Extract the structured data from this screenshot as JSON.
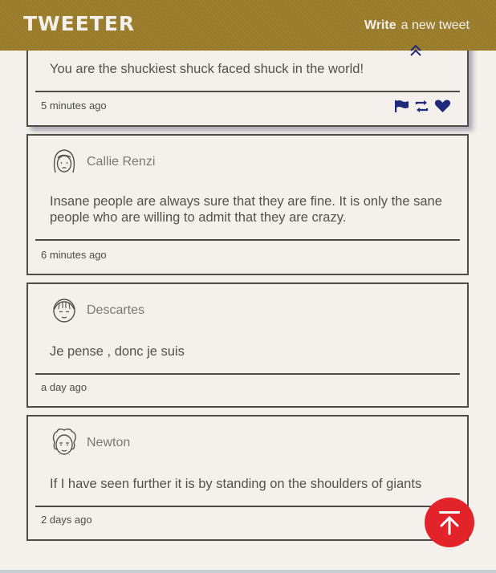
{
  "nav": {
    "brand": "TWEETER",
    "write_label": "Write",
    "new_tweet_label": "a new tweet"
  },
  "tweets": [
    {
      "content": "You are the shuckiest shuck faced shuck in the world!",
      "time": "5 minutes ago",
      "actions": [
        "flag-icon",
        "retweet-icon",
        "heart-icon"
      ]
    },
    {
      "handle": "Callie Renzi",
      "content": "Insane people are always sure that they are fine. It is only the sane people who are willing to admit that they are crazy.",
      "time": "6 minutes ago"
    },
    {
      "handle": "Descartes",
      "content": "Je pense , donc je suis",
      "time": "a day ago"
    },
    {
      "handle": "Newton",
      "content": "If I have seen further it is by standing on the shoulders of giants",
      "time": "2 days ago"
    }
  ],
  "colors": {
    "nav_bg": "#9c7e2b",
    "page_bg": "#f4f1ec",
    "accent_navy": "#1f2a7a",
    "fab_red": "#e3232a"
  }
}
